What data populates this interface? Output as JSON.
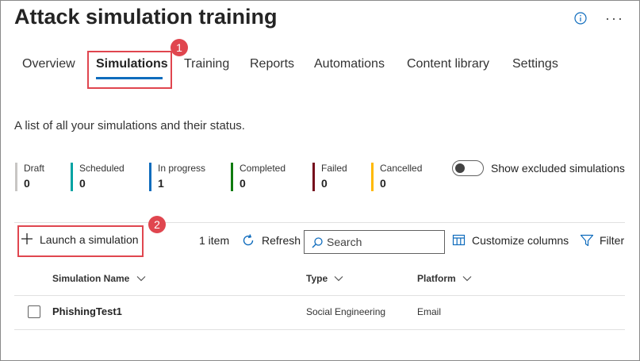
{
  "page": {
    "title": "Attack simulation training",
    "description": "A list of all your simulations and their status."
  },
  "header_icons": [
    "info-icon",
    "more-icon"
  ],
  "tabs": [
    {
      "label": "Overview"
    },
    {
      "label": "Simulations",
      "active": true
    },
    {
      "label": "Training"
    },
    {
      "label": "Reports"
    },
    {
      "label": "Automations"
    },
    {
      "label": "Content library"
    },
    {
      "label": "Settings"
    }
  ],
  "callouts": [
    "1",
    "2"
  ],
  "statuses": [
    {
      "label": "Draft",
      "count": "0",
      "color": "#c8c6c4"
    },
    {
      "label": "Scheduled",
      "count": "0",
      "color": "#00a3a3"
    },
    {
      "label": "In progress",
      "count": "1",
      "color": "#0f6cbd"
    },
    {
      "label": "Completed",
      "count": "0",
      "color": "#107c10"
    },
    {
      "label": "Failed",
      "count": "0",
      "color": "#750b1c"
    },
    {
      "label": "Cancelled",
      "count": "0",
      "color": "#ffb900"
    }
  ],
  "toggle": {
    "label": "Show excluded simulations",
    "on": false
  },
  "toolbar": {
    "launch_label": "Launch a simulation",
    "item_count": "1 item",
    "refresh_label": "Refresh",
    "search_placeholder": "Search",
    "customize_label": "Customize columns",
    "filter_label": "Filter"
  },
  "table": {
    "columns": [
      "Simulation Name",
      "Type",
      "Platform"
    ],
    "rows": [
      {
        "name": "PhishingTest1",
        "type": "Social Engineering",
        "platform": "Email"
      }
    ]
  },
  "colors": {
    "accent": "#0f6cbd",
    "callout": "#e0464f"
  }
}
